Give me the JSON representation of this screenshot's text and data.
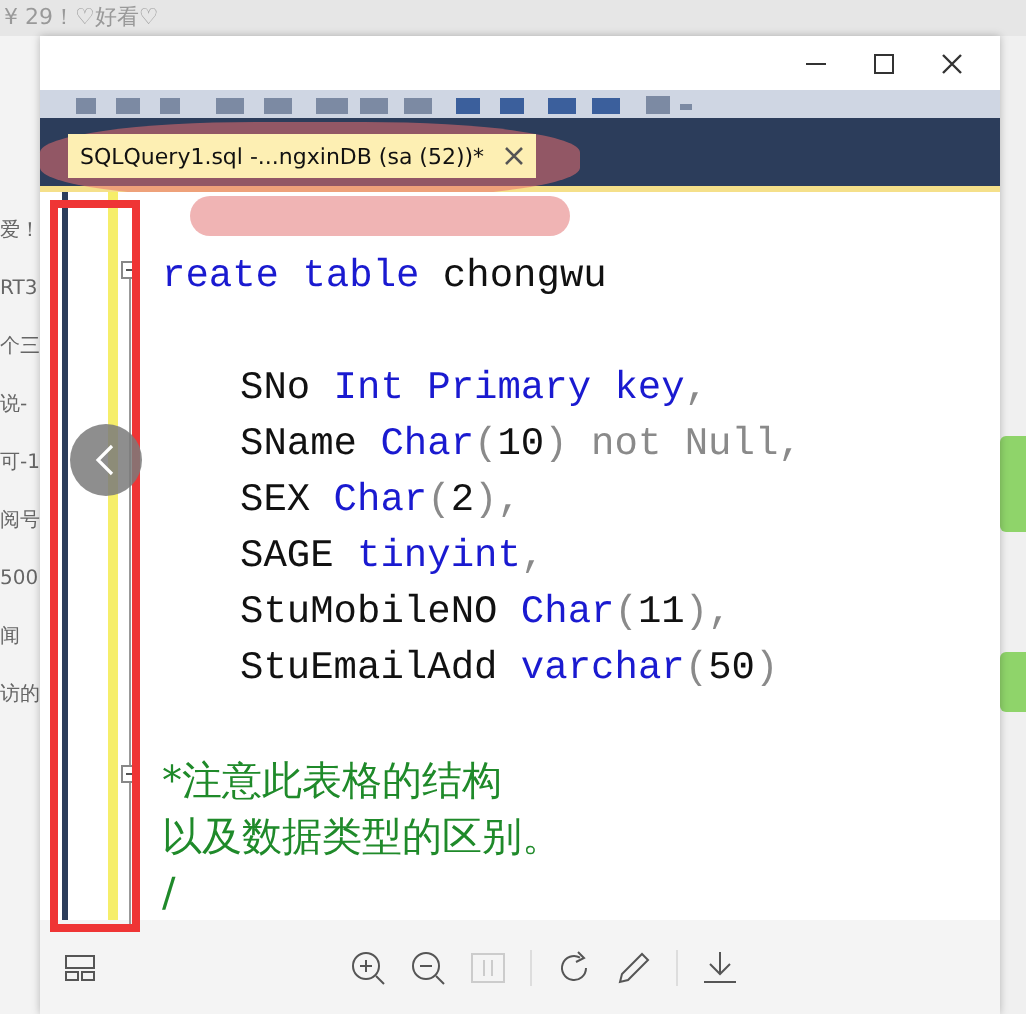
{
  "background_page": {
    "top_text": "¥ 29！♡好看♡",
    "left_fragments": [
      "爱！",
      "RT3",
      "个三",
      "说-",
      "可-1",
      "阅号",
      "500",
      "闻",
      "访的"
    ]
  },
  "viewer": {
    "document_tab": {
      "title": "SQLQuery1.sql -...ngxinDB (sa (52))*",
      "selected": true
    },
    "code_lines": [
      {
        "kind": "blank"
      },
      {
        "kind": "code",
        "indented": false,
        "tokens": [
          {
            "text": "reate table",
            "kind": "keyword"
          },
          {
            "text": " chongwu",
            "kind": "plain"
          }
        ]
      },
      {
        "kind": "blank"
      },
      {
        "kind": "code",
        "indented": true,
        "tokens": [
          {
            "text": "SNo",
            "kind": "plain"
          },
          {
            "text": " Int Primary key",
            "kind": "keyword"
          },
          {
            "text": ",",
            "kind": "gray"
          }
        ]
      },
      {
        "kind": "code",
        "indented": true,
        "tokens": [
          {
            "text": "SName",
            "kind": "plain"
          },
          {
            "text": " Char",
            "kind": "keyword"
          },
          {
            "text": "(",
            "kind": "gray"
          },
          {
            "text": "10",
            "kind": "plain"
          },
          {
            "text": ") not Null,",
            "kind": "gray"
          }
        ]
      },
      {
        "kind": "code",
        "indented": true,
        "tokens": [
          {
            "text": "SEX",
            "kind": "plain"
          },
          {
            "text": " Char",
            "kind": "keyword"
          },
          {
            "text": "(",
            "kind": "gray"
          },
          {
            "text": "2",
            "kind": "plain"
          },
          {
            "text": "),",
            "kind": "gray"
          }
        ]
      },
      {
        "kind": "code",
        "indented": true,
        "tokens": [
          {
            "text": "SAGE",
            "kind": "plain"
          },
          {
            "text": " tinyint",
            "kind": "keyword"
          },
          {
            "text": ",",
            "kind": "gray"
          }
        ]
      },
      {
        "kind": "code",
        "indented": true,
        "tokens": [
          {
            "text": "StuMobileNO",
            "kind": "plain"
          },
          {
            "text": " Char",
            "kind": "keyword"
          },
          {
            "text": "(",
            "kind": "gray"
          },
          {
            "text": "11",
            "kind": "plain"
          },
          {
            "text": "),",
            "kind": "gray"
          }
        ]
      },
      {
        "kind": "code",
        "indented": true,
        "tokens": [
          {
            "text": "StuEmailAdd",
            "kind": "plain"
          },
          {
            "text": " varchar",
            "kind": "keyword"
          },
          {
            "text": "(",
            "kind": "gray"
          },
          {
            "text": "50",
            "kind": "plain"
          },
          {
            "text": ")",
            "kind": "gray"
          }
        ]
      },
      {
        "kind": "blank"
      },
      {
        "kind": "code",
        "indented": false,
        "tokens": [
          {
            "text": "*注意此表格的结构",
            "kind": "comment"
          }
        ]
      },
      {
        "kind": "code",
        "indented": false,
        "tokens": [
          {
            "text": "以及数据类型的区别。",
            "kind": "comment"
          }
        ]
      },
      {
        "kind": "code",
        "indented": false,
        "tokens": [
          {
            "text": "/",
            "kind": "comment"
          }
        ]
      }
    ]
  }
}
